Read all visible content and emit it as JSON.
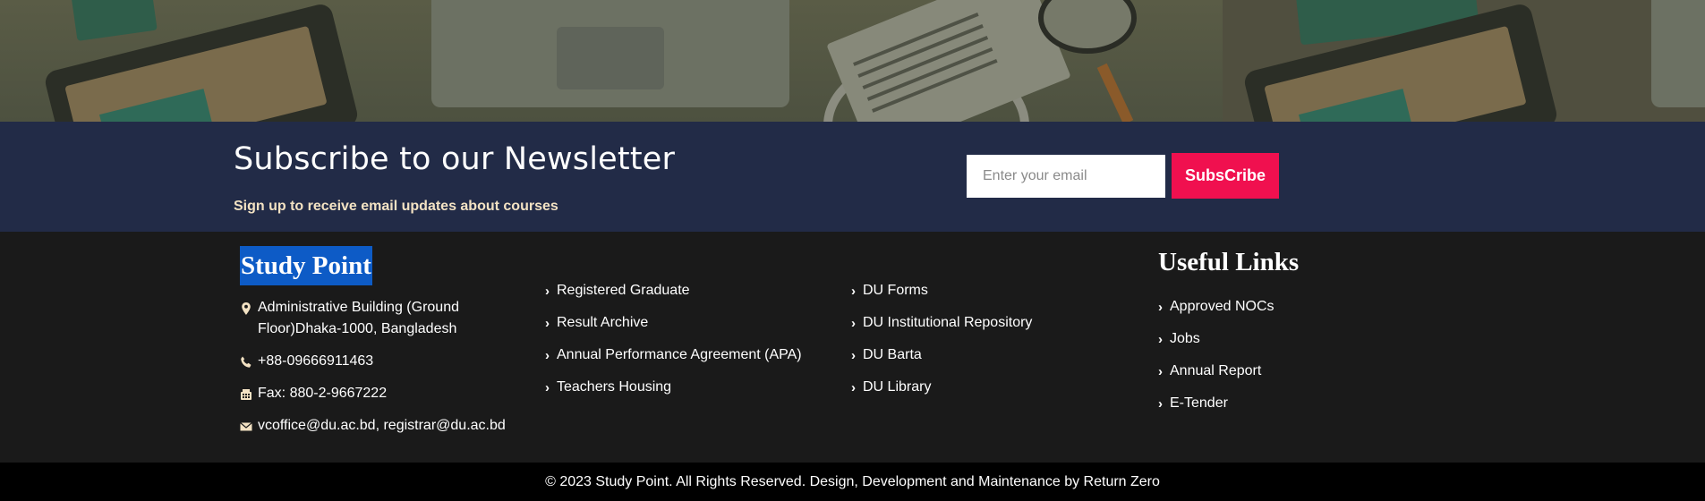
{
  "newsletter": {
    "title": "Subscribe to our Newsletter",
    "subtitle": "Sign up to receive email updates about courses",
    "email_placeholder": "Enter your email",
    "button_label": "SubsCribe"
  },
  "footer": {
    "brand": "Study Point",
    "contact": {
      "address": "Administrative Building (Ground Floor)Dhaka-1000, Bangladesh",
      "phone": "+88-09666911463",
      "fax": "Fax: 880-2-9667222",
      "email": "vcoffice@du.ac.bd, registrar@du.ac.bd"
    },
    "links_col1": [
      {
        "label": "Registered Graduate"
      },
      {
        "label": "Result Archive"
      },
      {
        "label": "Annual Performance Agreement (APA)"
      },
      {
        "label": "Teachers Housing"
      }
    ],
    "links_col2": [
      {
        "label": "DU Forms"
      },
      {
        "label": "DU Institutional Repository"
      },
      {
        "label": "DU Barta"
      },
      {
        "label": "DU Library"
      }
    ],
    "useful_links": {
      "heading": "Useful Links",
      "items": [
        {
          "label": "Approved NOCs"
        },
        {
          "label": "Jobs"
        },
        {
          "label": "Annual Report"
        },
        {
          "label": "E-Tender"
        }
      ]
    },
    "copyright": "© 2023 Study Point. All Rights Reserved. Design, Development and Maintenance by Return Zero"
  },
  "colors": {
    "newsletter_bg": "#222b47",
    "accent_button": "#f0104f",
    "footer_bg": "#1a1a1a",
    "brand_highlight": "#0d5bc6",
    "bottom_bar_bg": "#000000"
  },
  "icons": {
    "address": "map-marker-icon",
    "phone": "phone-icon",
    "fax": "fax-icon",
    "email": "envelope-icon",
    "link": "chevron-right-icon"
  }
}
